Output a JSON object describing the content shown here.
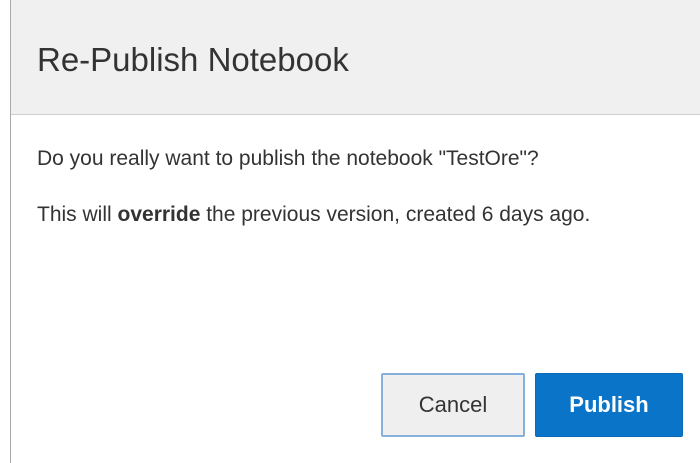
{
  "dialog": {
    "title": "Re-Publish Notebook",
    "message_line1": "Do you really want to publish the notebook \"TestOre\"?",
    "message_line2_pre": "This will ",
    "message_line2_bold": "override",
    "message_line2_post": " the previous version, created 6 days ago.",
    "cancel_label": "Cancel",
    "publish_label": "Publish"
  },
  "colors": {
    "header_bg": "#f0f0f0",
    "primary": "#0a74c9",
    "cancel_border": "#87b1dd"
  }
}
